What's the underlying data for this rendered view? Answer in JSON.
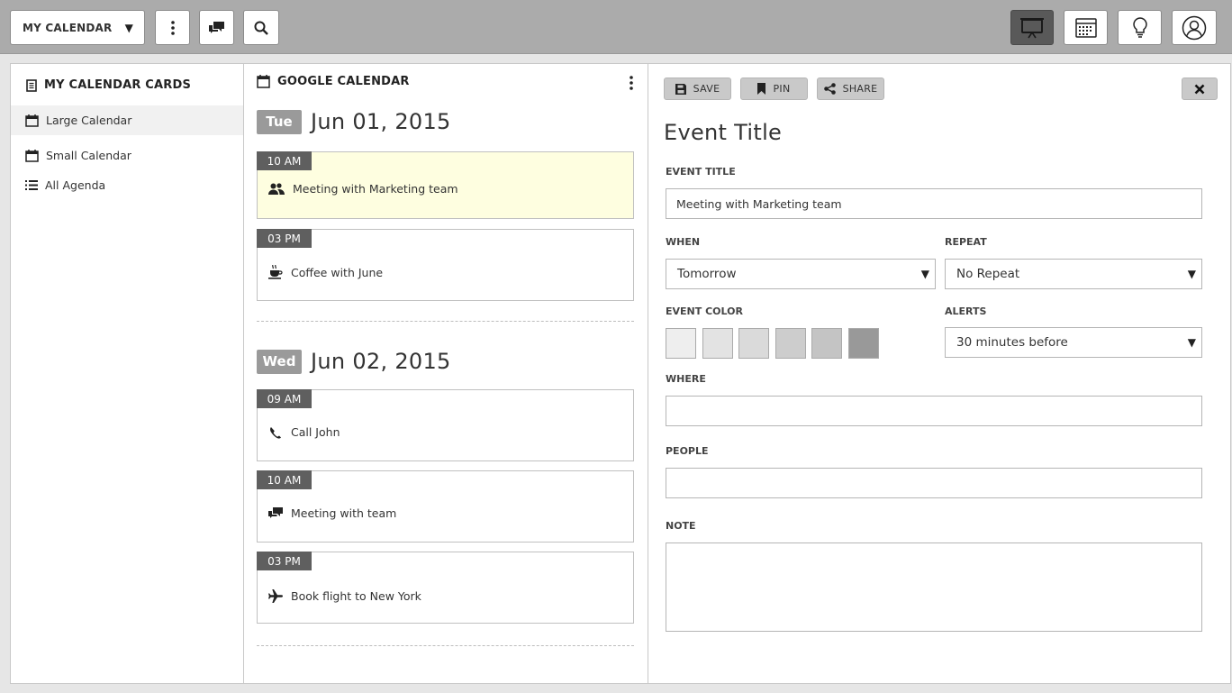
{
  "topbar": {
    "calendar_select": "MY CALENDAR",
    "buttons": {
      "more": "more-vertical-icon",
      "chat": "chat-icon",
      "search": "search-icon",
      "presentation": "presentation-icon",
      "calendar_view": "calendar-grid-icon",
      "tips": "lightbulb-icon",
      "profile": "user-icon"
    }
  },
  "sidebar": {
    "title": "MY CALENDAR CARDS",
    "items": [
      {
        "label": "Large Calendar",
        "icon": "calendar-icon",
        "active": true
      },
      {
        "label": "Small Calendar",
        "icon": "calendar-icon",
        "active": false
      },
      {
        "label": "All Agenda",
        "icon": "list-icon",
        "active": false
      }
    ]
  },
  "agenda": {
    "title": "GOOGLE CALENDAR",
    "days": [
      {
        "day": "Tue",
        "date": "Jun 01, 2015",
        "events": [
          {
            "time": "10 AM",
            "title": "Meeting with Marketing team",
            "icon": "people-icon",
            "highlighted": true
          },
          {
            "time": "03 PM",
            "title": "Coffee with June",
            "icon": "coffee-icon",
            "highlighted": false
          }
        ]
      },
      {
        "day": "Wed",
        "date": "Jun 02, 2015",
        "events": [
          {
            "time": "09 AM",
            "title": "Call John",
            "icon": "phone-icon",
            "highlighted": false
          },
          {
            "time": "10 AM",
            "title": "Meeting with team",
            "icon": "chat-icon",
            "highlighted": false
          },
          {
            "time": "03 PM",
            "title": "Book flight to New York",
            "icon": "plane-icon",
            "highlighted": false
          }
        ]
      }
    ]
  },
  "detail": {
    "actions": {
      "save": "SAVE",
      "pin": "PIN",
      "share": "SHARE"
    },
    "heading": "Event Title",
    "event_title_label": "EVENT TITLE",
    "event_title_value": "Meeting with Marketing team",
    "when_label": "WHEN",
    "when_value": "Tomorrow",
    "repeat_label": "REPEAT",
    "repeat_value": "No Repeat",
    "color_label": "EVENT COLOR",
    "colors": [
      "#eeeeee",
      "#e3e3e3",
      "#dadada",
      "#cdcdcd",
      "#c4c4c4",
      "#999999"
    ],
    "alerts_label": "ALERTS",
    "alerts_value": "30 minutes before",
    "where_label": "WHERE",
    "where_value": "",
    "people_label": "PEOPLE",
    "people_value": "",
    "note_label": "NOTE",
    "note_value": ""
  }
}
